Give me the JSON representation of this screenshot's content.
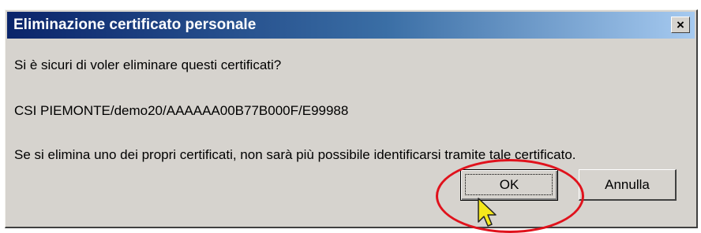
{
  "dialog": {
    "title": "Eliminazione certificato personale",
    "close_label": "×",
    "question": "Si è sicuri di voler eliminare questi certificati?",
    "certificate": "CSI PIEMONTE/demo20/AAAAAA00B77B000F/E99988",
    "warning": "Se si elimina uno dei propri certificati, non sarà più possibile identificarsi tramite tale certificato.",
    "ok_label": "OK",
    "cancel_label": "Annulla"
  },
  "annotation": {
    "highlight_color": "#e0121c",
    "cursor_icon": "mouse-pointer-icon",
    "cursor_color": "#f5e81c"
  },
  "colors": {
    "title_gradient_start": "#0a246a",
    "title_gradient_end": "#a6caf0",
    "dialog_background": "#d6d3ce"
  }
}
